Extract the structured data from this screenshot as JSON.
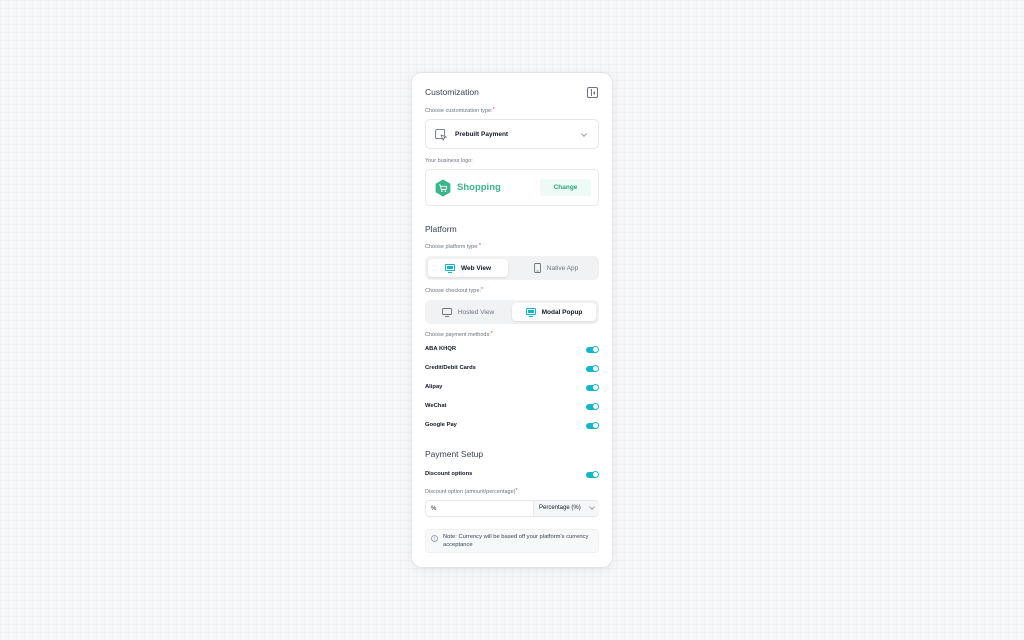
{
  "customization": {
    "title": "Customization",
    "type_label": "Choose customization type:",
    "type_value": "Prebuilt Payment",
    "logo_label": "Your business logo:",
    "logo_text": "Shopping",
    "change_label": "Change"
  },
  "platform": {
    "title": "Platform",
    "platform_label": "Choose platform type:",
    "platform_options": [
      "Web View",
      "Native App"
    ],
    "platform_selected": "Web View",
    "checkout_label": "Choose checkout type:",
    "checkout_options": [
      "Hosted View",
      "Modal Popup"
    ],
    "checkout_selected": "Modal Popup",
    "methods_label": "Choose payment methods:",
    "methods": [
      {
        "label": "ABA KHQR",
        "enabled": true
      },
      {
        "label": "Credit/Debit Cards",
        "enabled": true
      },
      {
        "label": "Alipay",
        "enabled": true
      },
      {
        "label": "WeChat",
        "enabled": true
      },
      {
        "label": "Google Pay",
        "enabled": true
      }
    ]
  },
  "payment_setup": {
    "title": "Payment Setup",
    "discount_label": "Discount options",
    "discount_enabled": true,
    "discount_option_label": "Discount option (amount/percentage)",
    "input_value": "%",
    "select_value": "Percentage (%)",
    "note": "Note: Currency will be based off your platform's currency acceptance"
  },
  "required_mark": "*",
  "colors": {
    "accent": "#16b6c8",
    "brand_green": "#3bb58a",
    "required": "#ef4444"
  }
}
